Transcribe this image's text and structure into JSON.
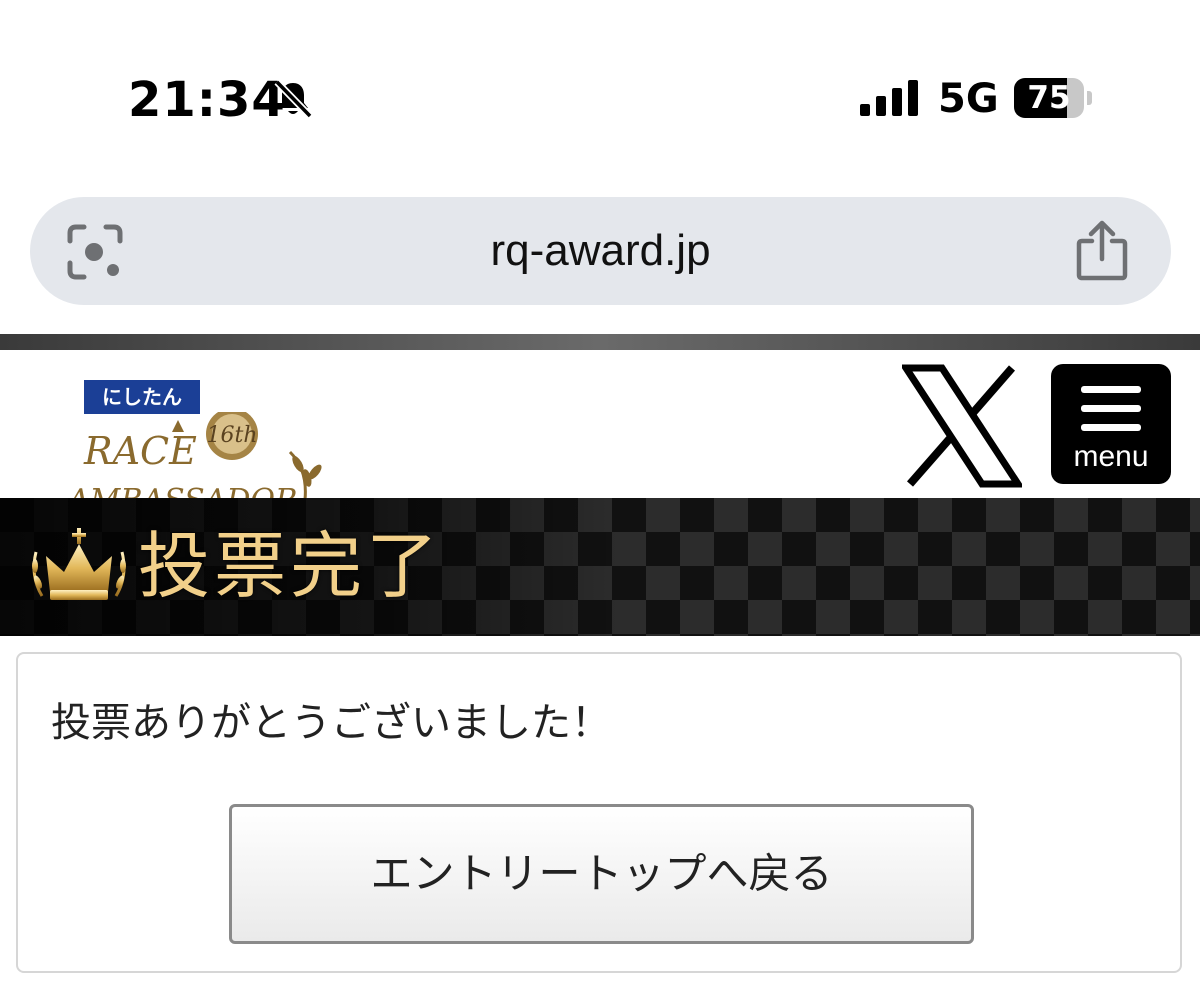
{
  "status_bar": {
    "time": "21:34",
    "network": "5G",
    "battery": {
      "label": "75",
      "level_percent": 75
    },
    "icons": [
      "bell-slash-icon",
      "signal-icon",
      "battery-icon"
    ]
  },
  "browser": {
    "url": "rq-award.jp",
    "icons": [
      "lens-icon",
      "share-icon"
    ]
  },
  "header": {
    "sponsor_logo_text": "にしたん",
    "brand_logo_text": "RACE AMBASSADOR 16th",
    "menu_label": "menu",
    "icons": [
      "x-logo-icon",
      "hamburger-icon"
    ]
  },
  "banner": {
    "title": "投票完了",
    "icon": "crown-icon",
    "title_color": "#f2d08a"
  },
  "content": {
    "message": "投票ありがとうございました！",
    "back_button_label": "エントリートップへ戻る"
  }
}
